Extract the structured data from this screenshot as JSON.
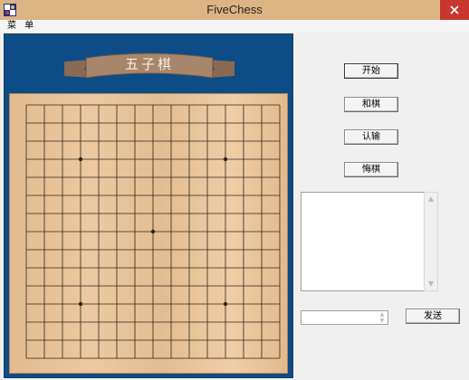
{
  "window": {
    "title": "FiveChess"
  },
  "menu": {
    "label": "菜 单"
  },
  "banner": {
    "title": "五子棋"
  },
  "board": {
    "size": 15,
    "star_points": [
      [
        3,
        3
      ],
      [
        11,
        3
      ],
      [
        7,
        7
      ],
      [
        3,
        11
      ],
      [
        11,
        11
      ]
    ],
    "line_color": "#2f2418"
  },
  "buttons": {
    "start": "开始",
    "draw": "和棋",
    "resign": "认输",
    "undo": "悔棋",
    "send": "发送"
  },
  "chat": {
    "log": "",
    "input_value": ""
  },
  "colors": {
    "title_bar": "#dcb484",
    "board_frame": "#0d4c86",
    "close": "#c7372f"
  }
}
